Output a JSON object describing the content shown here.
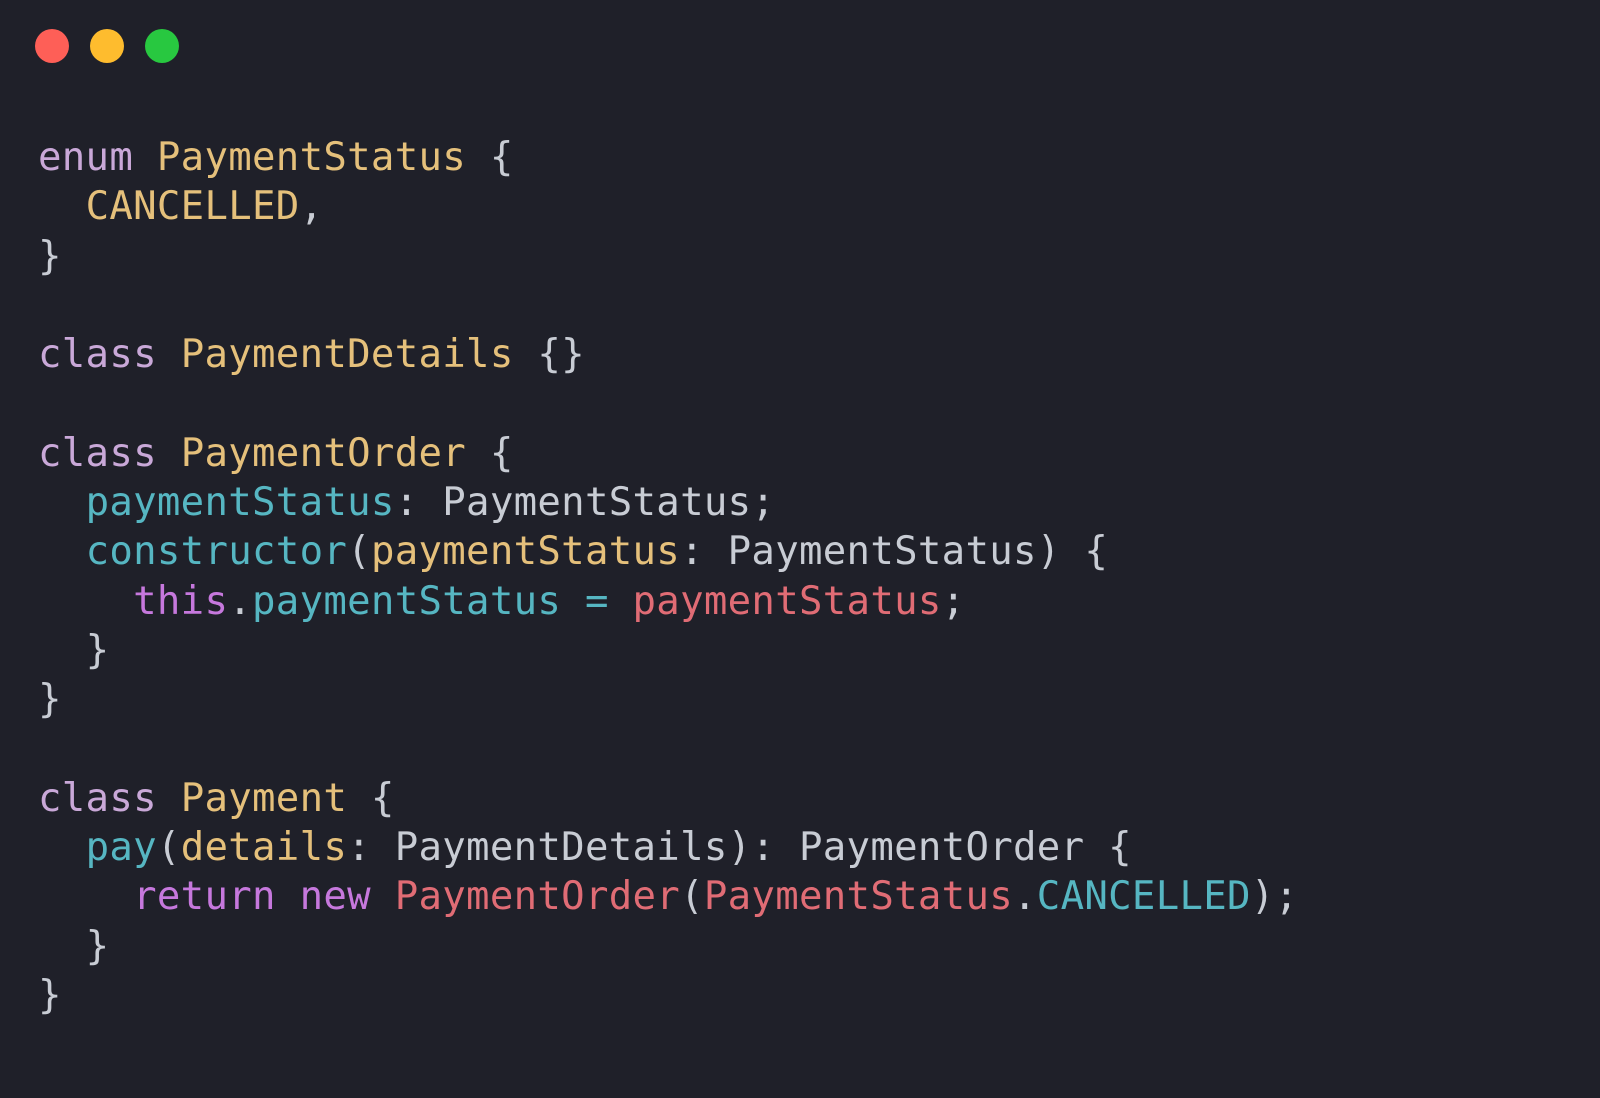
{
  "window": {
    "controls": [
      {
        "name": "close",
        "color": "#fe5f57"
      },
      {
        "name": "minimize",
        "color": "#febc2e"
      },
      {
        "name": "zoom",
        "color": "#28c840"
      }
    ]
  },
  "colors": {
    "background": "#1f2029",
    "keyword": "#c678dd",
    "keyword_light": "#c9a8d8",
    "type": "#e5c07b",
    "property": "#56b6c2",
    "variable": "#e06c75",
    "punctuation": "#c8ccd4"
  },
  "code": {
    "lines": [
      [
        {
          "text": "enum",
          "kind": "kw-light"
        },
        {
          "text": " ",
          "kind": "plain"
        },
        {
          "text": "PaymentStatus",
          "kind": "type"
        },
        {
          "text": " {",
          "kind": "punc"
        }
      ],
      [
        {
          "text": "  ",
          "kind": "plain"
        },
        {
          "text": "CANCELLED",
          "kind": "type"
        },
        {
          "text": ",",
          "kind": "punc"
        }
      ],
      [
        {
          "text": "}",
          "kind": "punc"
        }
      ],
      [],
      [
        {
          "text": "class",
          "kind": "kw-light"
        },
        {
          "text": " ",
          "kind": "plain"
        },
        {
          "text": "PaymentDetails",
          "kind": "type"
        },
        {
          "text": " {}",
          "kind": "punc"
        }
      ],
      [],
      [
        {
          "text": "class",
          "kind": "kw-light"
        },
        {
          "text": " ",
          "kind": "plain"
        },
        {
          "text": "PaymentOrder",
          "kind": "type"
        },
        {
          "text": " {",
          "kind": "punc"
        }
      ],
      [
        {
          "text": "  ",
          "kind": "plain"
        },
        {
          "text": "paymentStatus",
          "kind": "prop"
        },
        {
          "text": ": ",
          "kind": "punc"
        },
        {
          "text": "PaymentStatus",
          "kind": "plain"
        },
        {
          "text": ";",
          "kind": "punc"
        }
      ],
      [
        {
          "text": "  ",
          "kind": "plain"
        },
        {
          "text": "constructor",
          "kind": "prop"
        },
        {
          "text": "(",
          "kind": "punc"
        },
        {
          "text": "paymentStatus",
          "kind": "type"
        },
        {
          "text": ": ",
          "kind": "punc"
        },
        {
          "text": "PaymentStatus",
          "kind": "plain"
        },
        {
          "text": ") {",
          "kind": "punc"
        }
      ],
      [
        {
          "text": "    ",
          "kind": "plain"
        },
        {
          "text": "this",
          "kind": "kw"
        },
        {
          "text": ".",
          "kind": "punc"
        },
        {
          "text": "paymentStatus",
          "kind": "prop"
        },
        {
          "text": " ",
          "kind": "plain"
        },
        {
          "text": "=",
          "kind": "prop"
        },
        {
          "text": " ",
          "kind": "plain"
        },
        {
          "text": "paymentStatus",
          "kind": "var"
        },
        {
          "text": ";",
          "kind": "punc"
        }
      ],
      [
        {
          "text": "  ",
          "kind": "plain"
        },
        {
          "text": "}",
          "kind": "punc"
        }
      ],
      [
        {
          "text": "}",
          "kind": "punc"
        }
      ],
      [],
      [
        {
          "text": "class",
          "kind": "kw-light"
        },
        {
          "text": " ",
          "kind": "plain"
        },
        {
          "text": "Payment",
          "kind": "type"
        },
        {
          "text": " {",
          "kind": "punc"
        }
      ],
      [
        {
          "text": "  ",
          "kind": "plain"
        },
        {
          "text": "pay",
          "kind": "prop"
        },
        {
          "text": "(",
          "kind": "punc"
        },
        {
          "text": "details",
          "kind": "type"
        },
        {
          "text": ": ",
          "kind": "punc"
        },
        {
          "text": "PaymentDetails",
          "kind": "plain"
        },
        {
          "text": "): ",
          "kind": "punc"
        },
        {
          "text": "PaymentOrder",
          "kind": "plain"
        },
        {
          "text": " {",
          "kind": "punc"
        }
      ],
      [
        {
          "text": "    ",
          "kind": "plain"
        },
        {
          "text": "return",
          "kind": "kw"
        },
        {
          "text": " ",
          "kind": "plain"
        },
        {
          "text": "new",
          "kind": "kw"
        },
        {
          "text": " ",
          "kind": "plain"
        },
        {
          "text": "PaymentOrder",
          "kind": "var"
        },
        {
          "text": "(",
          "kind": "punc"
        },
        {
          "text": "PaymentStatus",
          "kind": "var"
        },
        {
          "text": ".",
          "kind": "punc"
        },
        {
          "text": "CANCELLED",
          "kind": "prop"
        },
        {
          "text": ");",
          "kind": "punc"
        }
      ],
      [
        {
          "text": "  ",
          "kind": "plain"
        },
        {
          "text": "}",
          "kind": "punc"
        }
      ],
      [
        {
          "text": "}",
          "kind": "punc"
        }
      ]
    ]
  }
}
